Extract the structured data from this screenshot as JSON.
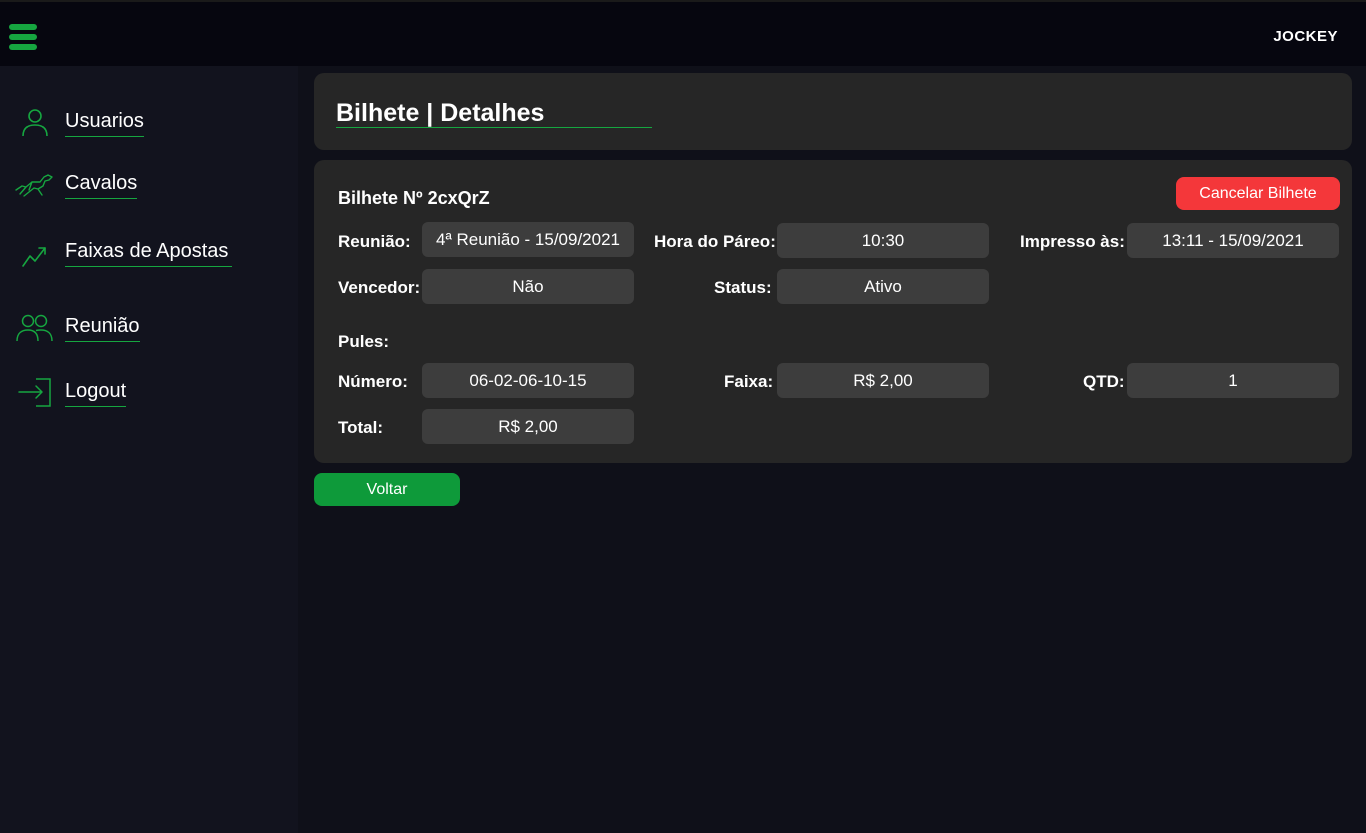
{
  "header": {
    "brand": "JOCKEY",
    "menu_icon": "hamburger-menu-icon"
  },
  "sidebar": {
    "items": [
      {
        "label": "Usuarios",
        "icon": "user-icon"
      },
      {
        "label": "Cavalos",
        "icon": "horse-icon"
      },
      {
        "label": "Faixas de Apostas",
        "icon": "trending-up-icon"
      },
      {
        "label": "Reunião",
        "icon": "users-icon"
      },
      {
        "label": "Logout",
        "icon": "logout-icon"
      }
    ]
  },
  "page": {
    "title": "Bilhete | Detalhes"
  },
  "ticket": {
    "number_label": "Bilhete Nº 2cxQrZ",
    "cancel_label": "Cancelar Bilhete",
    "reuniao_label": "Reunião:",
    "reuniao_value": "4ª Reunião - 15/09/2021",
    "hora_label": "Hora do Páreo:",
    "hora_value": "10:30",
    "impresso_label": "Impresso às:",
    "impresso_value": "13:11 - 15/09/2021",
    "vencedor_label": "Vencedor:",
    "vencedor_value": "Não",
    "status_label": "Status:",
    "status_value": "Ativo",
    "pules_label": "Pules:",
    "numero_label": "Número:",
    "numero_value": "06-02-06-10-15",
    "faixa_label": "Faixa:",
    "faixa_value": "R$ 2,00",
    "qtd_label": "QTD:",
    "qtd_value": "1",
    "total_label": "Total:",
    "total_value": "R$ 2,00"
  },
  "actions": {
    "back_label": "Voltar"
  },
  "colors": {
    "accent": "#16a640",
    "danger": "#f4373a",
    "button_green": "#0e9a3a",
    "card": "#262626",
    "field": "#3d3d3d"
  }
}
